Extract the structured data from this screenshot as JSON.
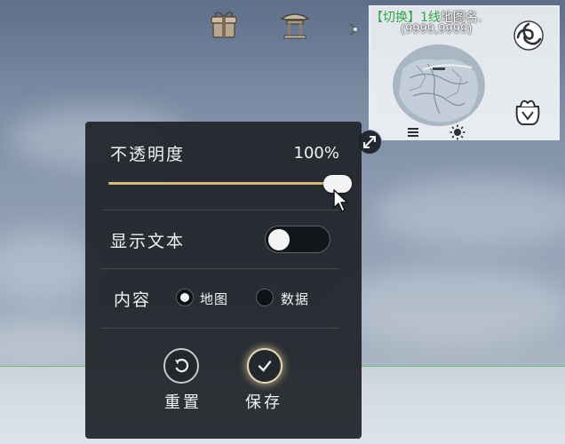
{
  "minimap": {
    "switch_label": "【切换】",
    "line_label": "1线",
    "map_name": "地图名.",
    "coords": "(9999,9999)"
  },
  "settings": {
    "opacity": {
      "label": "不透明度",
      "value_text": "100%",
      "value": 1.0
    },
    "show_text": {
      "label": "显示文本",
      "enabled": false
    },
    "content": {
      "label": "内容",
      "options": [
        "地图",
        "数据"
      ],
      "selected": "地图"
    },
    "reset_label": "重置",
    "save_label": "保存"
  },
  "colors": {
    "accent": "#d7b877",
    "panel_bg": "#202329",
    "switch_green": "#2fa84a"
  },
  "icons": [
    "gift-icon",
    "pavilion-icon",
    "arrow-icon",
    "spiral-icon",
    "bag-icon",
    "menu-icon",
    "sun-icon",
    "expand-icon",
    "reset-icon",
    "check-icon",
    "cursor-icon"
  ]
}
